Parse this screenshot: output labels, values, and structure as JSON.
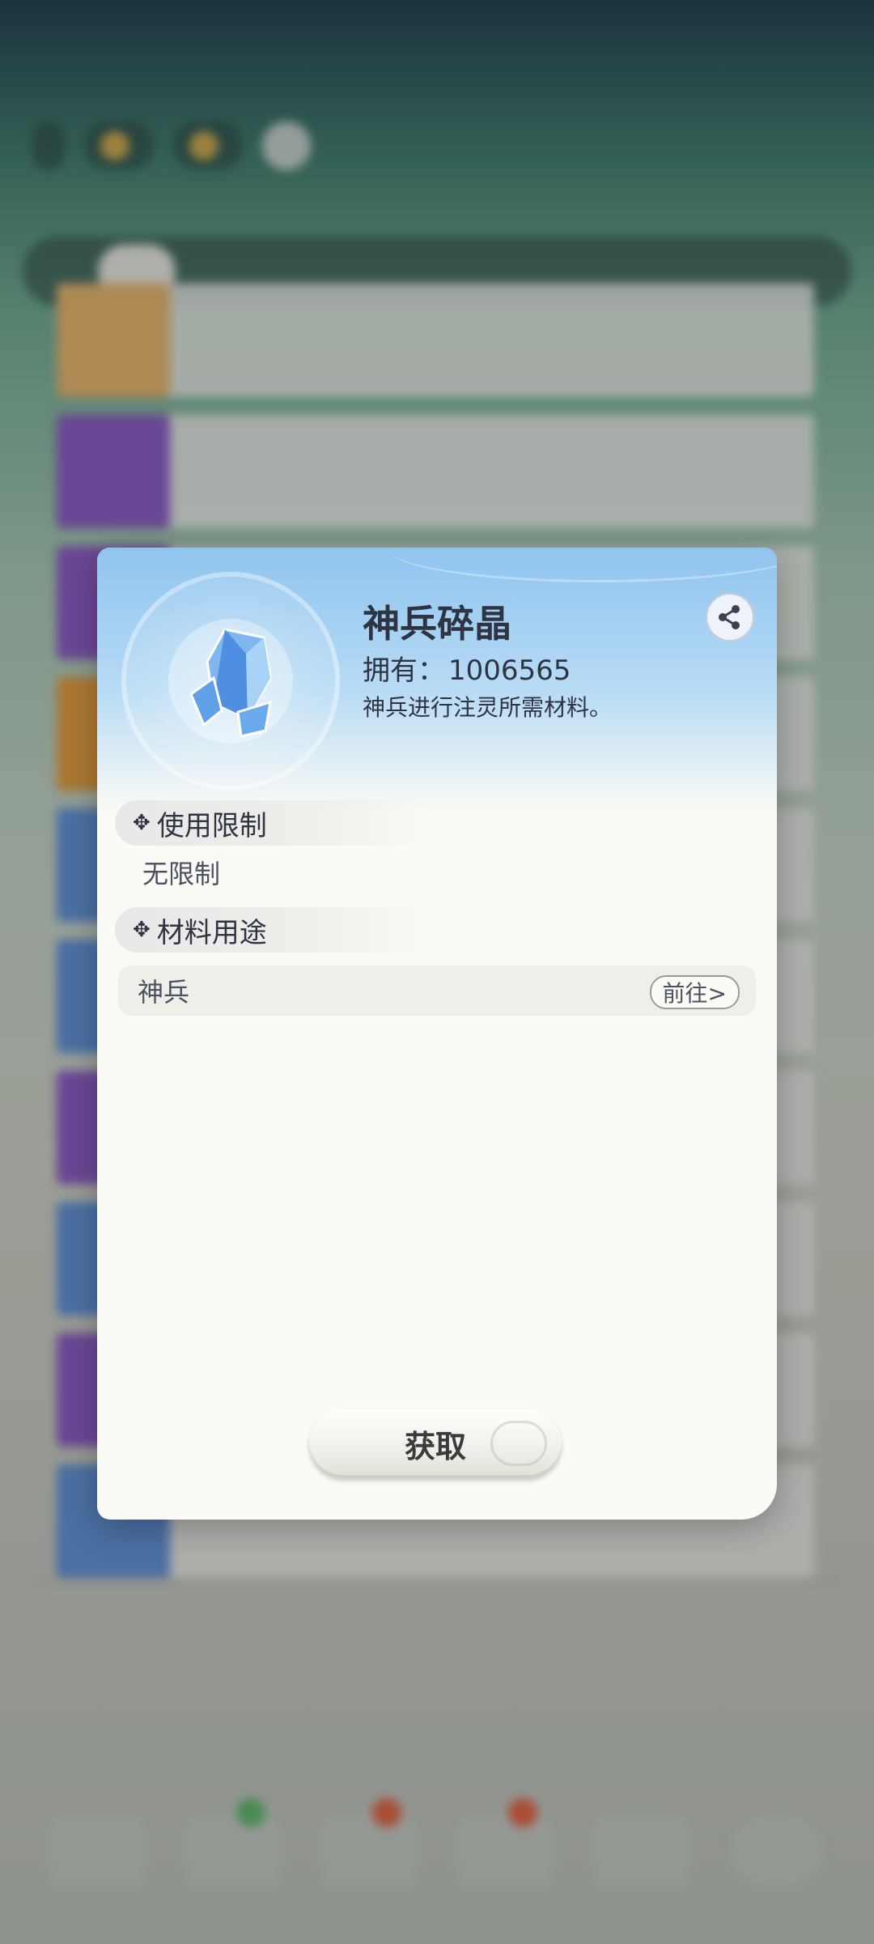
{
  "background": {
    "resources": [
      "",
      ""
    ],
    "tabs": [
      "",
      "",
      "",
      "",
      ""
    ],
    "list_rows": [
      {
        "name": "",
        "qty": ""
      },
      {
        "name": "",
        "qty": ""
      },
      {
        "name": "",
        "qty": ""
      },
      {
        "name": "",
        "qty": ""
      },
      {
        "name": "",
        "qty": ""
      },
      {
        "name": "",
        "qty": ""
      },
      {
        "name": "",
        "qty": ""
      },
      {
        "name": "",
        "qty": ""
      },
      {
        "name": "",
        "qty": ""
      },
      {
        "name": "",
        "qty": ""
      }
    ],
    "capacity_text": "",
    "row_colors": [
      "#e8b36a",
      "#8b57c3",
      "#8b57c3",
      "#e39a3a",
      "#5f8fd6",
      "#5f8fd6",
      "#8b57c3",
      "#5f8fd6",
      "#8b57c3",
      "#5f8fd6"
    ]
  },
  "modal": {
    "item_name": "神兵碎晶",
    "owned_label": "拥有：",
    "owned_value": "1006565",
    "description": "神兵进行注灵所需材料。",
    "sections": {
      "restriction_title": "使用限制",
      "restriction_value": "无限制",
      "usage_title": "材料用途"
    },
    "usage_items": [
      {
        "label": "神兵",
        "action": "前往>"
      }
    ],
    "obtain_button": "获取",
    "icons": {
      "share": "share-icon",
      "item": "crystal-icon"
    }
  },
  "colors": {
    "header_blue": "#8fc4ef",
    "text_dark": "#2f3443",
    "panel_bg": "#fbfbf5"
  }
}
